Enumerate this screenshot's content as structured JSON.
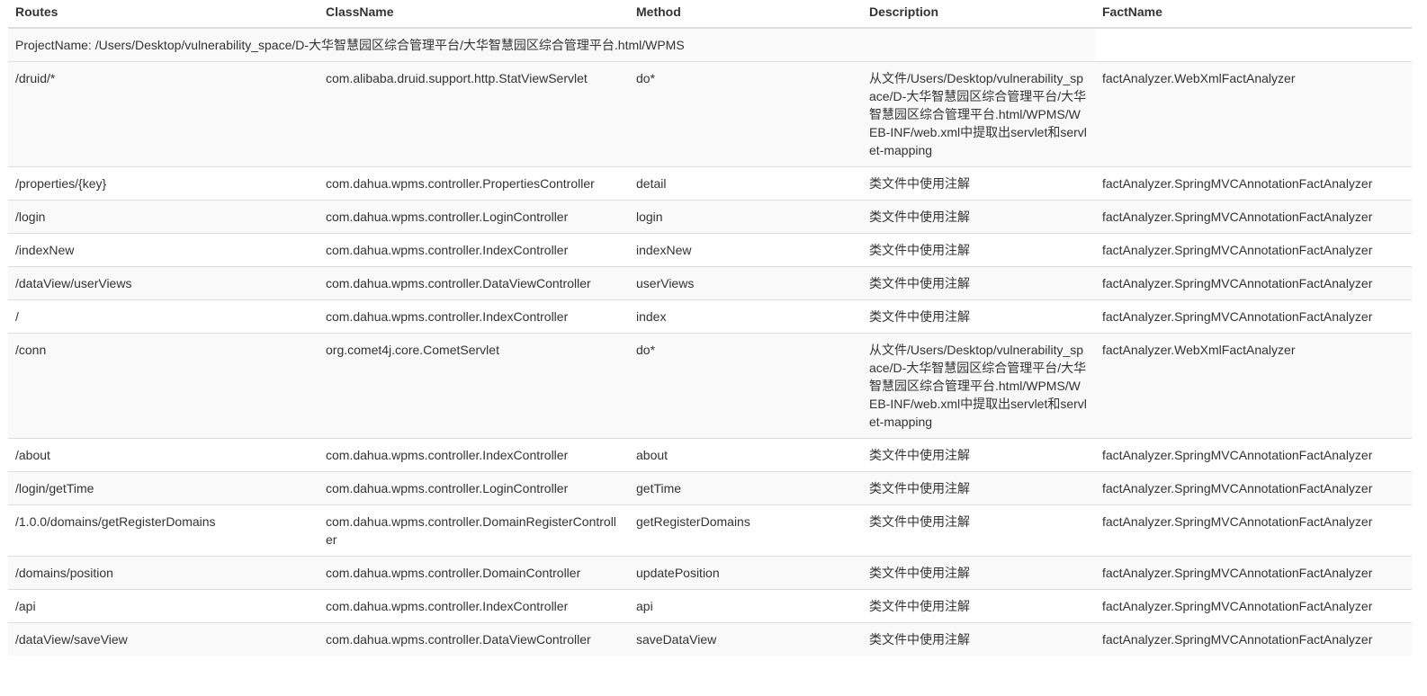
{
  "table": {
    "headers": {
      "routes": "Routes",
      "classname": "ClassName",
      "method": "Method",
      "description": "Description",
      "factname": "FactName"
    },
    "project_name": "ProjectName: /Users/Desktop/vulnerability_space/D-大华智慧园区综合管理平台/大华智慧园区综合管理平台.html/WPMS",
    "rows": [
      {
        "route": "/druid/*",
        "classname": "com.alibaba.druid.support.http.StatViewServlet",
        "method": "do*",
        "description": "从文件/Users/Desktop/vulnerability_space/D-大华智慧园区综合管理平台/大华智慧园区综合管理平台.html/WPMS/WEB-INF/web.xml中提取出servlet和servlet-mapping",
        "factname": "factAnalyzer.WebXmlFactAnalyzer"
      },
      {
        "route": "/properties/{key}",
        "classname": "com.dahua.wpms.controller.PropertiesController",
        "method": "detail",
        "description": "类文件中使用注解",
        "factname": "factAnalyzer.SpringMVCAnnotationFactAnalyzer"
      },
      {
        "route": "/login",
        "classname": "com.dahua.wpms.controller.LoginController",
        "method": "login",
        "description": "类文件中使用注解",
        "factname": "factAnalyzer.SpringMVCAnnotationFactAnalyzer"
      },
      {
        "route": "/indexNew",
        "classname": "com.dahua.wpms.controller.IndexController",
        "method": "indexNew",
        "description": "类文件中使用注解",
        "factname": "factAnalyzer.SpringMVCAnnotationFactAnalyzer"
      },
      {
        "route": "/dataView/userViews",
        "classname": "com.dahua.wpms.controller.DataViewController",
        "method": "userViews",
        "description": "类文件中使用注解",
        "factname": "factAnalyzer.SpringMVCAnnotationFactAnalyzer"
      },
      {
        "route": "/",
        "classname": "com.dahua.wpms.controller.IndexController",
        "method": "index",
        "description": "类文件中使用注解",
        "factname": "factAnalyzer.SpringMVCAnnotationFactAnalyzer"
      },
      {
        "route": "/conn",
        "classname": "org.comet4j.core.CometServlet",
        "method": "do*",
        "description": "从文件/Users/Desktop/vulnerability_space/D-大华智慧园区综合管理平台/大华智慧园区综合管理平台.html/WPMS/WEB-INF/web.xml中提取出servlet和servlet-mapping",
        "factname": "factAnalyzer.WebXmlFactAnalyzer"
      },
      {
        "route": "/about",
        "classname": "com.dahua.wpms.controller.IndexController",
        "method": "about",
        "description": "类文件中使用注解",
        "factname": "factAnalyzer.SpringMVCAnnotationFactAnalyzer"
      },
      {
        "route": "/login/getTime",
        "classname": "com.dahua.wpms.controller.LoginController",
        "method": "getTime",
        "description": "类文件中使用注解",
        "factname": "factAnalyzer.SpringMVCAnnotationFactAnalyzer"
      },
      {
        "route": "/1.0.0/domains/getRegisterDomains",
        "classname": "com.dahua.wpms.controller.DomainRegisterController",
        "method": "getRegisterDomains",
        "description": "类文件中使用注解",
        "factname": "factAnalyzer.SpringMVCAnnotationFactAnalyzer"
      },
      {
        "route": "/domains/position",
        "classname": "com.dahua.wpms.controller.DomainController",
        "method": "updatePosition",
        "description": "类文件中使用注解",
        "factname": "factAnalyzer.SpringMVCAnnotationFactAnalyzer"
      },
      {
        "route": "/api",
        "classname": "com.dahua.wpms.controller.IndexController",
        "method": "api",
        "description": "类文件中使用注解",
        "factname": "factAnalyzer.SpringMVCAnnotationFactAnalyzer"
      },
      {
        "route": "/dataView/saveView",
        "classname": "com.dahua.wpms.controller.DataViewController",
        "method": "saveDataView",
        "description": "类文件中使用注解",
        "factname": "factAnalyzer.SpringMVCAnnotationFactAnalyzer"
      }
    ]
  }
}
